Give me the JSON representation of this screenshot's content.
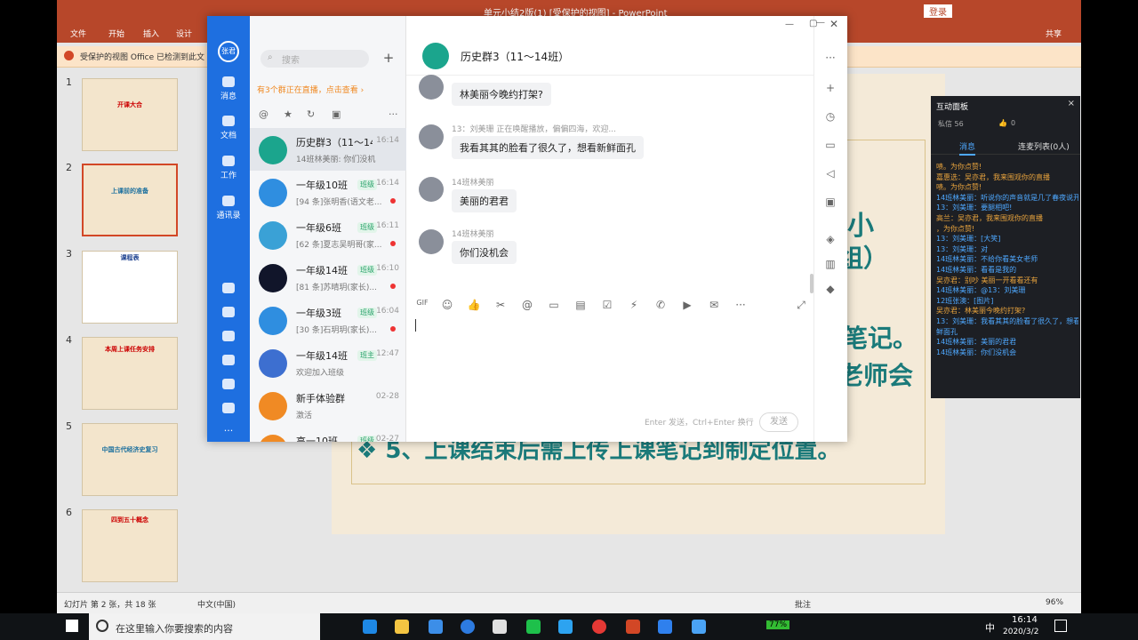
{
  "ppt": {
    "title": "单元小结2版(1) [受保护的视图] - PowerPoint",
    "login": "登录",
    "share": "共享",
    "ribbon": [
      "文件",
      "开始",
      "插入",
      "设计"
    ],
    "warning": "受保护的视图   Office 已检测到此文",
    "thumbs": [
      {
        "num": "1",
        "text": "开课大合"
      },
      {
        "num": "2",
        "text": "上课前的准备"
      },
      {
        "num": "3",
        "text": "课程表"
      },
      {
        "num": "4",
        "text": "本周上课任务安排"
      },
      {
        "num": "5",
        "text": "中国古代经济史复习"
      },
      {
        "num": "6",
        "text": "四到五十概念"
      }
    ],
    "slide_texts": [
      "的小",
      "组）",
      "笔记。",
      "老师会",
      "❖ 5、上课结束后需上传上课笔记到制定位置。"
    ],
    "status": {
      "slide_info": "幻灯片 第 2 张，共 18 张",
      "lang": "中文(中国)",
      "notes": "批注",
      "zoom": "96%"
    }
  },
  "chat": {
    "nav": [
      "消息",
      "文档",
      "工作",
      "通讯录"
    ],
    "nav_logo": "张君",
    "search_placeholder": "搜索",
    "plus": "+",
    "live_banner": "有3个群正在直播，点击查看 ›",
    "filter_icons": [
      "@",
      "★",
      "↻",
      "▣",
      "···"
    ],
    "conversations": [
      {
        "name": "历史群3（11～14班）",
        "time": "16:14",
        "preview": "14班林美丽: 你们没机",
        "color": "#1ba58d",
        "active": true,
        "tag": ""
      },
      {
        "name": "一年级10班",
        "time": "16:14",
        "preview": "[94 条]张明香(语文老...",
        "color": "#2f8ee0",
        "tag": "班级",
        "dot": true
      },
      {
        "name": "一年级6班",
        "time": "16:11",
        "preview": "[62 条]夏志吴明哥(家...",
        "color": "#3aa1d6",
        "tag": "班级",
        "dot": true
      },
      {
        "name": "一年级14班",
        "time": "16:10",
        "preview": "[81 条]苏晴玥(家长)...",
        "color": "#11152a",
        "tag": "班级",
        "dot": true
      },
      {
        "name": "一年级3班",
        "time": "16:04",
        "preview": "[30 条]石玥玥(家长)...",
        "color": "#2f8ee0",
        "tag": "班级",
        "dot": true
      },
      {
        "name": "一年级14班",
        "time": "12:47",
        "preview": "欢迎加入班级",
        "color": "#3d6fd0",
        "tag": "班主"
      },
      {
        "name": "新手体验群",
        "time": "02-28",
        "preview": "激活",
        "color": "#f08a24",
        "tag": ""
      },
      {
        "name": "高一10班",
        "time": "02-27",
        "preview": "",
        "color": "#f08a24",
        "tag": "班级"
      }
    ],
    "header_title": "历史群3（11～14班）",
    "messages": [
      {
        "sender": "",
        "text": "林美丽今晚约打架?"
      },
      {
        "sender": "13：刘美珊    正在唤醒播放，偏偏四海，欢迎...",
        "text": "我看其其的脸看了很久了，想看新鲜面孔"
      },
      {
        "sender": "14班林美丽",
        "text": "美丽的君君"
      },
      {
        "sender": "14班林美丽",
        "text": "你们没机会"
      }
    ],
    "toolbar_icons": [
      "GIF",
      "☺",
      "👍",
      "✂",
      "@",
      "▭",
      "▤",
      "☑",
      "⚡",
      "✆",
      "▶",
      "✉",
      "···"
    ],
    "send_hint": "Enter 发送，Ctrl+Enter 换行",
    "send": "发送",
    "right_icons": [
      "···",
      "+",
      "◷",
      "▭",
      "◁",
      "▣",
      "◈",
      "▥",
      "◆"
    ]
  },
  "panel": {
    "title": "互动面板",
    "likes": "0",
    "views": "56",
    "views_label": "私信 56",
    "tabs": [
      "消息",
      "连麦列表(0人)"
    ],
    "messages": [
      {
        "text": "啧。为你点赞!",
        "color": "#e8a33d"
      },
      {
        "text": "嘉惠选：吴亦君，我来围观你的直播",
        "color": "#e8a33d"
      },
      {
        "text": "啧。为你点赞!",
        "color": "#e8a33d"
      },
      {
        "text": "14班林美丽：听说你的声音就是几了春夜说开",
        "color": "#4ea8ff"
      },
      {
        "text": "13：刘美珊：要腿相吧!",
        "color": "#4ea8ff"
      },
      {
        "text": "高兰：吴亦君，我来围观你的直播",
        "color": "#e8a33d"
      },
      {
        "text": "，为你点赞!",
        "color": "#e8a33d"
      },
      {
        "text": "13：刘美珊：[大笑]",
        "color": "#4ea8ff"
      },
      {
        "text": "13：刘美珊：对",
        "color": "#4ea8ff"
      },
      {
        "text": "14班林美丽：不给你看美女老师",
        "color": "#4ea8ff"
      },
      {
        "text": "14班林美丽：看看是我的",
        "color": "#4ea8ff"
      },
      {
        "text": "吴亦君：别吵 美丽一开看看还有",
        "color": "#e8a33d"
      },
      {
        "text": "14班林美丽：@13：刘美珊",
        "color": "#4ea8ff"
      },
      {
        "text": "12班张澳：[图片]",
        "color": "#4ea8ff"
      },
      {
        "text": "吴亦君：林美丽今晚约打架?",
        "color": "#e8a33d"
      },
      {
        "text": "13：刘美珊：我看其其的脸看了很久了，想看新",
        "color": "#4ea8ff"
      },
      {
        "text": "鲜面孔",
        "color": "#4ea8ff"
      },
      {
        "text": "14班林美丽：美丽的君君",
        "color": "#4ea8ff"
      },
      {
        "text": "14班林美丽：你们没机会",
        "color": "#4ea8ff"
      }
    ]
  },
  "taskbar": {
    "search": "在这里输入你要搜索的内容",
    "time": "16:14",
    "date": "2020/3/2",
    "lang": "中",
    "battery": "77%"
  }
}
